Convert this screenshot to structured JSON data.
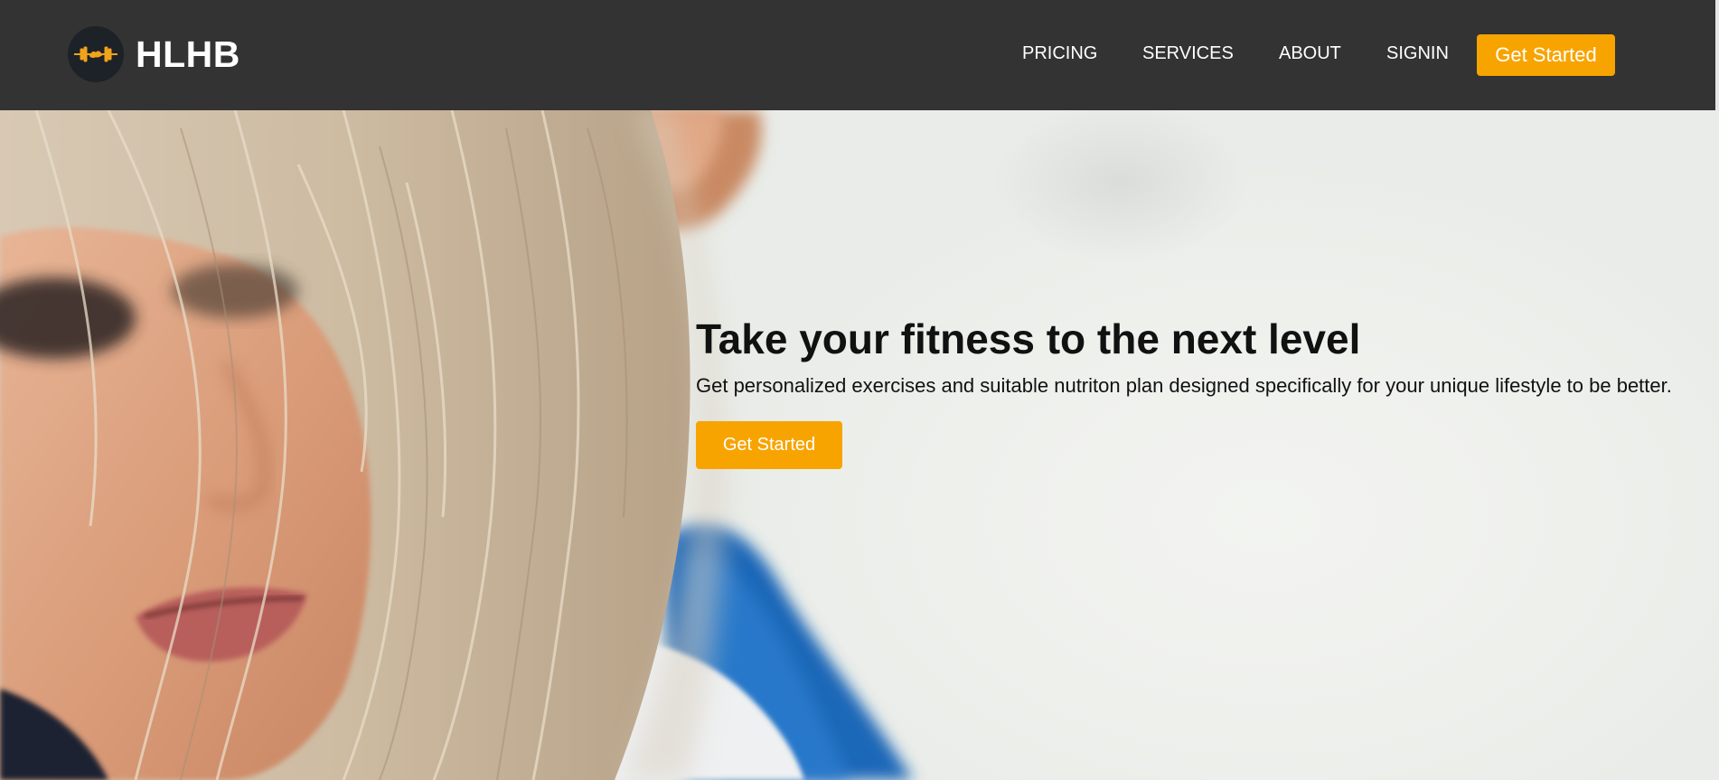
{
  "header": {
    "brand": "HLHB",
    "logo_icon": "barbell-icon",
    "nav": {
      "pricing": "PRICING",
      "services": "SERVICES",
      "about": "ABOUT",
      "signin": "SIGNIN"
    },
    "cta_label": "Get Started"
  },
  "hero": {
    "title": "Take your fitness to the next level",
    "subtitle": "Get personalized exercises and suitable nutriton plan designed specifically for your unique lifestyle to be better.",
    "cta_label": "Get Started"
  },
  "colors": {
    "navbar_bg": "#333333",
    "accent": "#f7a400",
    "text_dark": "#111111"
  }
}
